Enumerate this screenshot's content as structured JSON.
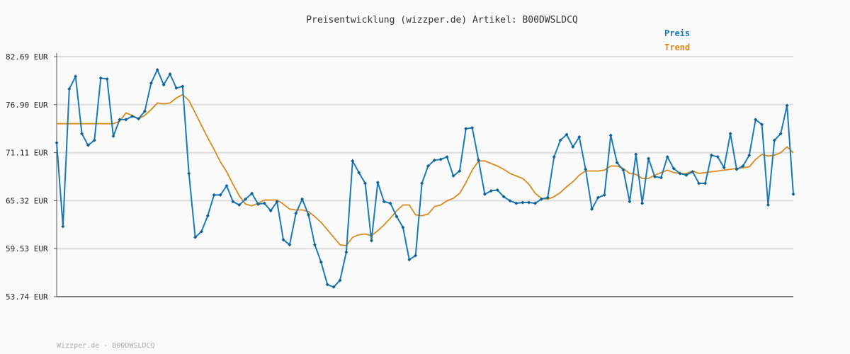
{
  "chart_data": {
    "type": "line",
    "title": "Preisentwicklung (wizzper.de) Artikel: B00DWSLDCQ",
    "ylim": [
      53.74,
      82.69
    ],
    "yticks": [
      "82.69 EUR",
      "76.90 EUR",
      "71.11 EUR",
      "65.32 EUR",
      "59.53 EUR",
      "53.74 EUR"
    ],
    "ytick_values": [
      82.69,
      76.9,
      71.11,
      65.32,
      59.53,
      53.74
    ],
    "grid": true,
    "legend_position": "top-right",
    "colors": {
      "preis": "#1a7bb8",
      "trend": "#d98a1f",
      "grid": "#dddddd",
      "axis": "#555555"
    },
    "series": [
      {
        "name": "Preis",
        "values": [
          72.3,
          62.2,
          78.8,
          80.3,
          73.4,
          72.0,
          72.6,
          80.1,
          80.0,
          73.1,
          75.1,
          75.1,
          75.5,
          75.2,
          76.1,
          79.5,
          81.1,
          79.3,
          80.6,
          78.9,
          79.1,
          68.6,
          60.9,
          61.6,
          63.5,
          66.0,
          66.0,
          67.1,
          65.2,
          64.8,
          65.5,
          66.2,
          64.9,
          65.0,
          64.1,
          65.2,
          60.6,
          60.0,
          63.8,
          65.5,
          63.6,
          60.0,
          57.9,
          55.2,
          54.9,
          55.7,
          59.1,
          70.1,
          68.7,
          67.4,
          60.5,
          67.5,
          65.2,
          65.0,
          63.4,
          62.1,
          58.2,
          58.7,
          67.4,
          69.5,
          70.2,
          70.3,
          70.6,
          68.3,
          68.9,
          74.0,
          74.1,
          70.2,
          66.1,
          66.5,
          66.6,
          65.8,
          65.3,
          65.0,
          65.1,
          65.1,
          65.0,
          65.5,
          65.7,
          70.6,
          72.6,
          73.3,
          71.8,
          73.0,
          69.1,
          64.3,
          65.7,
          66.0,
          73.2,
          69.9,
          69.0,
          65.2,
          70.9,
          65.0,
          70.4,
          68.2,
          68.1,
          70.6,
          69.2,
          68.6,
          68.4,
          68.8,
          67.4,
          67.4,
          70.8,
          70.6,
          69.3,
          73.4,
          69.1,
          69.5,
          70.8,
          75.1,
          74.5,
          64.8,
          72.6,
          73.4,
          76.8,
          66.1
        ]
      },
      {
        "name": "Trend",
        "values": [
          74.6,
          74.6,
          74.6,
          74.6,
          74.6,
          74.6,
          74.6,
          74.6,
          74.6,
          74.6,
          74.9,
          75.9,
          75.6,
          75.2,
          75.6,
          76.3,
          77.1,
          77.0,
          77.1,
          77.7,
          78.1,
          77.4,
          75.9,
          74.4,
          72.9,
          71.5,
          70.0,
          68.8,
          67.3,
          65.9,
          64.9,
          64.7,
          65.0,
          65.4,
          65.4,
          65.4,
          64.9,
          64.3,
          64.2,
          64.2,
          64.0,
          63.4,
          62.7,
          61.8,
          60.9,
          60.0,
          59.9,
          60.9,
          61.2,
          61.3,
          61.1,
          61.7,
          62.4,
          63.2,
          64.1,
          64.8,
          64.8,
          63.6,
          63.5,
          63.7,
          64.6,
          64.8,
          65.3,
          65.6,
          66.2,
          67.5,
          69.0,
          70.1,
          70.1,
          69.8,
          69.5,
          69.1,
          68.6,
          68.3,
          68.0,
          67.3,
          66.2,
          65.6,
          65.5,
          65.8,
          66.3,
          67.0,
          67.6,
          68.4,
          68.9,
          68.9,
          68.9,
          69.0,
          69.5,
          69.5,
          69.2,
          68.6,
          68.5,
          68.0,
          68.0,
          68.4,
          68.7,
          69.0,
          68.7,
          68.6,
          68.6,
          68.9,
          68.6,
          68.7,
          68.8,
          68.9,
          69.0,
          69.1,
          69.2,
          69.3,
          69.4,
          70.3,
          70.9,
          70.7,
          70.8,
          71.1,
          71.8,
          71.1
        ]
      }
    ]
  },
  "footer": "Wizzper.de - B00DWSLDCQ"
}
